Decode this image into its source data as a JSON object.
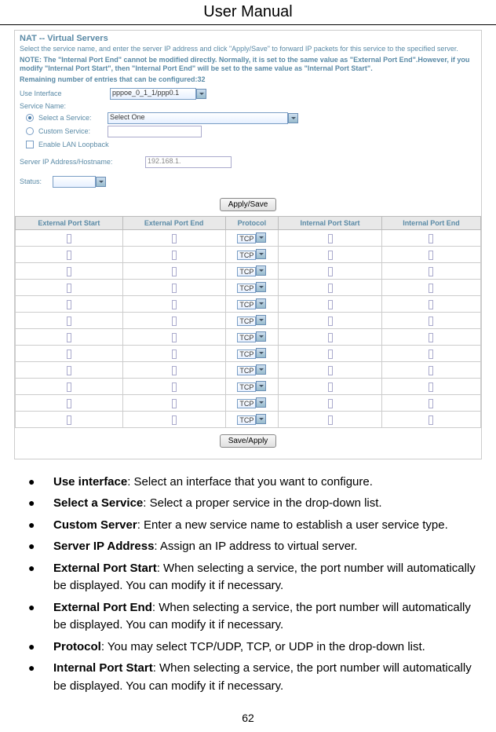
{
  "header": {
    "title": "User Manual"
  },
  "nat": {
    "title": "NAT -- Virtual Servers",
    "intro": "Select the service name, and enter the server IP address and click \"Apply/Save\" to forward IP packets for this service to the specified server.",
    "note_label": "NOTE:",
    "note_text": "The \"Internal Port End\" cannot be modified directly. Normally, it is set to the same value as \"External Port End\".However, if you modify \"Internal Port Start\", then \"Internal Port End\" will be set to the same value as \"Internal Port Start\".",
    "remaining_label": "Remaining number of entries that can be configured:",
    "remaining_value": "32",
    "use_interface_label": "Use Interface",
    "use_interface_value": "pppoe_0_1_1/ppp0.1",
    "service_name_label": "Service Name:",
    "select_service_label": "Select a Service:",
    "select_service_value": "Select One",
    "custom_service_label": "Custom Service:",
    "enable_lan_label": "Enable LAN Loopback",
    "server_ip_label": "Server IP Address/Hostname:",
    "server_ip_value": "192.168.1.",
    "status_label": "Status:",
    "apply_btn": "Apply/Save",
    "save_apply_btn": "Save/Apply",
    "table": {
      "headers": [
        "External Port Start",
        "External Port End",
        "Protocol",
        "Internal Port Start",
        "Internal Port End"
      ],
      "protocol_value": "TCP",
      "rows": 12
    }
  },
  "bullets": [
    {
      "bold": "Use interface",
      "text": ": Select an interface that you want to configure."
    },
    {
      "bold": "Select a Service",
      "text": ": Select a proper service in the drop-down list."
    },
    {
      "bold": "Custom Server",
      "text": ": Enter a new service name to establish a user service type."
    },
    {
      "bold": "Server IP Address",
      "text": ": Assign an IP address to virtual server."
    },
    {
      "bold": "External Port Start",
      "text": ": When selecting a service, the port number will automatically be displayed. You can modify it if necessary."
    },
    {
      "bold": "External Port End",
      "text": ": When selecting a service, the port number will automatically be displayed. You can modify it if necessary."
    },
    {
      "bold": "Protocol",
      "text": ": You may select TCP/UDP, TCP, or UDP in the drop-down list."
    },
    {
      "bold": "Internal Port Start",
      "text": ": When selecting a service, the port number will automatically be displayed. You can modify it if necessary."
    }
  ],
  "page_number": "62"
}
